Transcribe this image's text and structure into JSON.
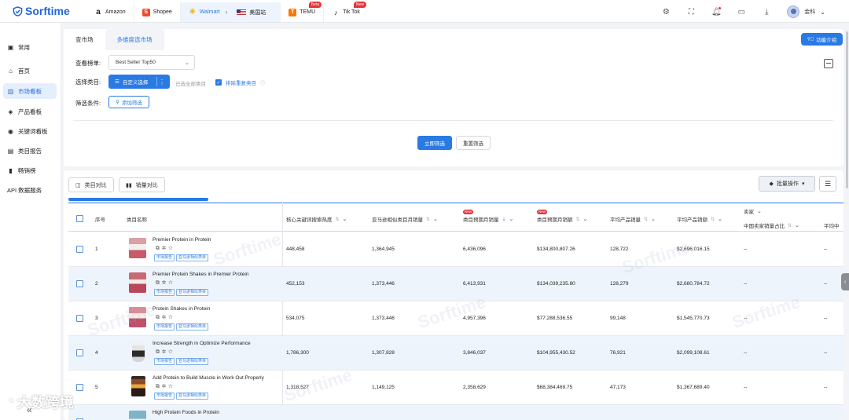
{
  "topbar": {
    "brand": "Sorftime",
    "sites": [
      {
        "label": "Amazon",
        "glyph": "a",
        "color": "#222222",
        "badge": ""
      },
      {
        "label": "Shopee",
        "glyph": "S",
        "color": "#ee4d2d",
        "badge": ""
      },
      {
        "label": "Walmart",
        "glyph": "✳",
        "color": "#f5b400",
        "badge": ""
      },
      {
        "label": "TEMU",
        "glyph": "T",
        "color": "#fb7701",
        "badge": "Beta"
      },
      {
        "label": "Tik Tok",
        "glyph": "♪",
        "color": "#111111",
        "badge": "New"
      }
    ],
    "region": "美国站",
    "user": "金科"
  },
  "sidebar": {
    "items": [
      {
        "label": "常用",
        "icon": "bookmark-icon"
      },
      {
        "label": "首页",
        "icon": "home-icon"
      },
      {
        "label": "市场看板",
        "icon": "market-icon",
        "active": true
      },
      {
        "label": "产品看板",
        "icon": "cube-icon"
      },
      {
        "label": "关键词看板",
        "icon": "keyword-icon"
      },
      {
        "label": "类目报告",
        "icon": "report-icon"
      },
      {
        "label": "畅销榜",
        "icon": "bar-chart-icon"
      },
      {
        "label": "API 数据服务",
        "icon": ""
      }
    ]
  },
  "main": {
    "tabs": [
      "查市场",
      "多维度选市场"
    ],
    "intro": "功能介绍",
    "list_label": "查看榜单:",
    "list_value": "Best Seller Top50",
    "category_label": "选择类目:",
    "custom_select": "自定义选择",
    "selected_all": "已选全部类目",
    "exclude_dup": "排除重复类目",
    "filter_label": "筛选条件:",
    "add_filter": "添加筛选",
    "apply": "立即筛选",
    "reset": "重置筛选"
  },
  "table": {
    "compare_category": "类目对比",
    "compare_sales": "销量对比",
    "batch": "批量操作",
    "headers": {
      "index": "序号",
      "name": "类目名称",
      "kw_heat": "核心关键词搜索热度",
      "amazon_sales": "亚马逊相似类目月销量",
      "forecast_sales": "类目预期月销量",
      "forecast_amount": "类目预期月销额",
      "avg_sales": "平均产品销量",
      "avg_amount": "平均产品销额",
      "seller": "卖家",
      "cn_seller_ratio": "中国卖家销量占比",
      "avg_trunc": "平均中"
    },
    "tag1": "市场报告",
    "tag2": "亚马逊相似类目",
    "rows": [
      {
        "index": "1",
        "name": "Premier Protein in Protein",
        "kw": "448,458",
        "amz": "1,364,945",
        "fs": "6,436,096",
        "fa": "$134,800,807.26",
        "as": "128,722",
        "aa": "$2,696,016.15",
        "seller": "--",
        "last": "--"
      },
      {
        "index": "2",
        "name": "Premier Protein Shakes in Premier Protein",
        "kw": "452,153",
        "amz": "1,373,446",
        "fs": "6,413,931",
        "fa": "$134,039,235.80",
        "as": "128,279",
        "aa": "$2,680,784.72",
        "seller": "--",
        "last": "--"
      },
      {
        "index": "3",
        "name": "Protein Shakes in Protein",
        "kw": "534,075",
        "amz": "1,373,446",
        "fs": "4,957,396",
        "fa": "$77,288,536.55",
        "as": "99,148",
        "aa": "$1,545,770.73",
        "seller": "--",
        "last": "--"
      },
      {
        "index": "4",
        "name": "Increase Strength in Optimize Performance",
        "kw": "1,786,300",
        "amz": "1,307,828",
        "fs": "3,846,037",
        "fa": "$104,955,430.52",
        "as": "76,921",
        "aa": "$2,099,108.61",
        "seller": "--",
        "last": "--"
      },
      {
        "index": "5",
        "name": "Add Protein to Build Muscle in Work Out Properly",
        "kw": "1,318,527",
        "amz": "1,149,125",
        "fs": "2,358,629",
        "fa": "$68,384,469.75",
        "as": "47,173",
        "aa": "$1,367,689.40",
        "seller": "--",
        "last": "--"
      },
      {
        "index": "6",
        "name": "High Protein Foods in Protein",
        "kw": "",
        "amz": "",
        "fs": "",
        "fa": "",
        "as": "",
        "aa": "",
        "seller": "",
        "last": ""
      }
    ]
  },
  "watermark": {
    "text": "Sorftime",
    "brand": "大数跨境"
  }
}
